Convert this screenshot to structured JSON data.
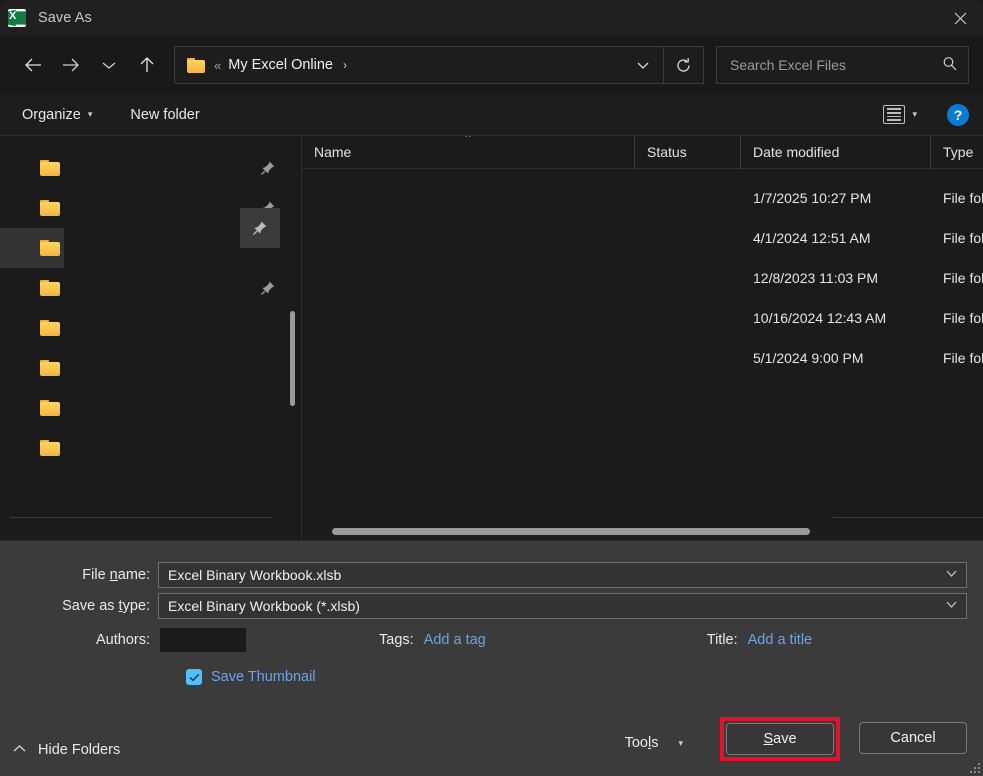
{
  "window": {
    "title": "Save As",
    "app_icon": "excel-icon",
    "close_label": "✕"
  },
  "navbar": {
    "back_icon": "arrow-left-icon",
    "forward_icon": "arrow-right-icon",
    "recent_icon": "chevron-down-icon",
    "up_icon": "arrow-up-icon",
    "address": {
      "folder_icon": "folder-icon",
      "overflow": "«",
      "crumb": "My Excel Online",
      "crumb_arrow": "›",
      "dropdown_icon": "chevron-down-icon",
      "refresh_icon": "refresh-icon"
    },
    "search": {
      "placeholder": "Search Excel Files",
      "icon": "search-icon"
    }
  },
  "commandbar": {
    "organize_label": "Organize",
    "organize_caret": "▾",
    "new_folder_label": "New folder",
    "view_icon": "list-view-icon",
    "view_caret": "▾",
    "help_label": "?"
  },
  "sidebar": {
    "items": [
      {
        "label": "",
        "icon": "folder-icon",
        "pinned": true,
        "selected": false
      },
      {
        "label": "",
        "icon": "folder-icon",
        "pinned": true,
        "selected": false
      },
      {
        "label": "",
        "icon": "folder-icon",
        "pinned": true,
        "selected": true
      },
      {
        "label": "",
        "icon": "folder-icon",
        "pinned": true,
        "selected": false
      },
      {
        "label": "",
        "icon": "folder-icon",
        "pinned": false,
        "selected": false
      },
      {
        "label": "",
        "icon": "folder-icon",
        "pinned": false,
        "selected": false
      },
      {
        "label": "",
        "icon": "folder-icon",
        "pinned": false,
        "selected": false
      },
      {
        "label": "",
        "icon": "folder-icon",
        "pinned": false,
        "selected": false
      }
    ]
  },
  "filelist": {
    "sort_indicator": "˄",
    "columns": [
      {
        "key": "name",
        "label": "Name"
      },
      {
        "key": "status",
        "label": "Status"
      },
      {
        "key": "date",
        "label": "Date modified"
      },
      {
        "key": "type",
        "label": "Type"
      }
    ],
    "rows": [
      {
        "name": "",
        "status": "",
        "date": "1/7/2025 10:27 PM",
        "type": "File fol"
      },
      {
        "name": "",
        "status": "",
        "date": "4/1/2024 12:51 AM",
        "type": "File fol"
      },
      {
        "name": "",
        "status": "",
        "date": "12/8/2023 11:03 PM",
        "type": "File fol"
      },
      {
        "name": "",
        "status": "",
        "date": "10/16/2024 12:43 AM",
        "type": "File fol"
      },
      {
        "name": "",
        "status": "",
        "date": "5/1/2024 9:00 PM",
        "type": "File fol"
      }
    ]
  },
  "form": {
    "filename_label_pre": "File ",
    "filename_label_key": "n",
    "filename_label_post": "ame:",
    "filename_value": "Excel Binary Workbook.xlsb",
    "savetype_label_pre": "Save as ",
    "savetype_label_key": "t",
    "savetype_label_post": "ype:",
    "savetype_value": "Excel Binary Workbook (*.xlsb)",
    "authors_label": "Authors:",
    "authors_value": "",
    "tags_label": "Tags:",
    "tags_link": "Add a tag",
    "title_label": "Title:",
    "title_link": "Add a title",
    "thumbnail_label": "Save Thumbnail",
    "thumbnail_checked": true
  },
  "footer": {
    "hide_folders_label": "Hide Folders",
    "hide_folders_icon": "chevron-up-icon",
    "tools_label_pre": "Too",
    "tools_label_key": "l",
    "tools_label_post": "s",
    "tools_caret": "▾",
    "save_label_key": "S",
    "save_label_post": "ave",
    "cancel_label": "Cancel",
    "save_highlighted": true
  },
  "colors": {
    "accent_blue": "#4cc2ff",
    "link_blue": "#6ba5e7",
    "highlight_red": "#e8112d",
    "folder_yellow": "#f5b53a",
    "help_blue": "#0a7bd4",
    "window_bg": "#202020",
    "panel_bg": "#3b3b3b",
    "list_bg": "#1b1b1b"
  }
}
